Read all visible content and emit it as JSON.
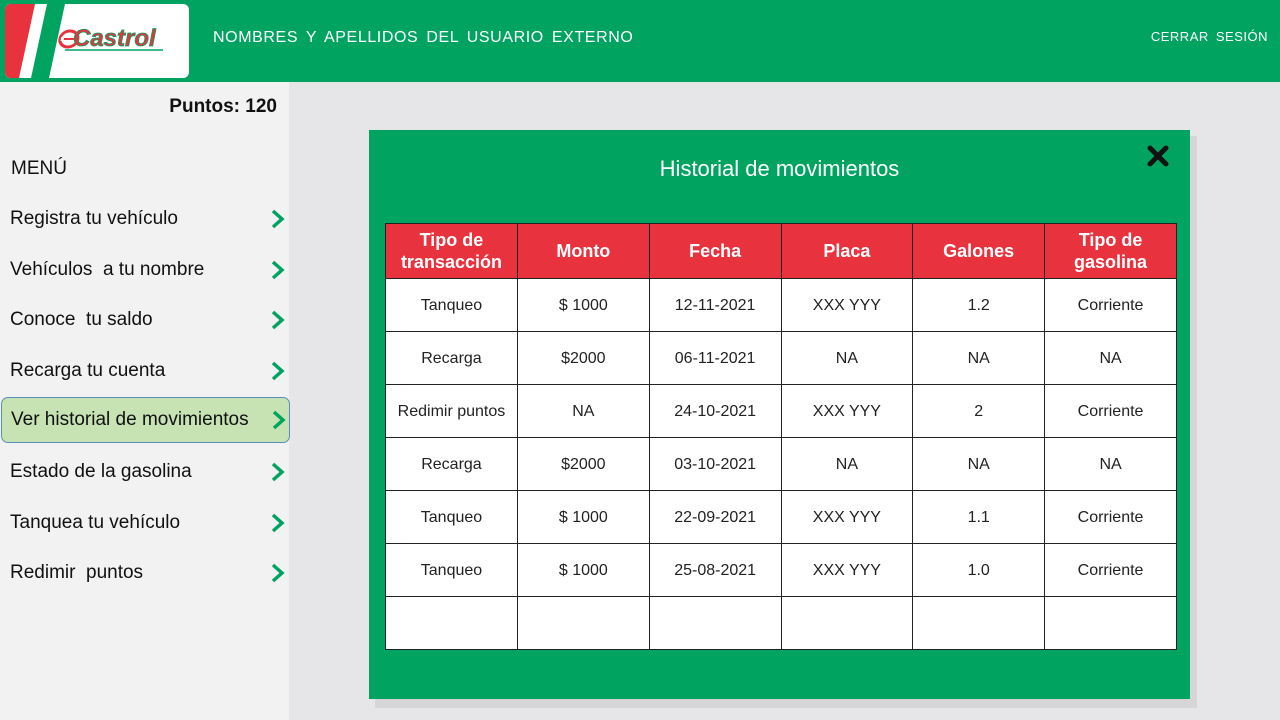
{
  "header": {
    "logo_text": "Castrol",
    "user_name": "NOMBRES Y APELLIDOS DEL USUARIO EXTERNO",
    "logout_label": "CERRAR SESIÓN",
    "colors": {
      "brand_green": "#00a460",
      "brand_red": "#e8323e"
    }
  },
  "sidebar": {
    "points_label": "Puntos: 120",
    "menu_title": "MENÚ",
    "items": [
      {
        "label": "Registra tu vehículo",
        "icon": "chevron-right-icon"
      },
      {
        "label": "Vehículos  a tu nombre",
        "icon": "chevron-right-icon"
      },
      {
        "label": "Conoce  tu saldo",
        "icon": "chevron-right-icon"
      },
      {
        "label": "Recarga tu cuenta",
        "icon": "chevron-right-icon"
      },
      {
        "label": "Ver historial de movimientos",
        "icon": "chevron-right-icon",
        "active": true
      },
      {
        "label": "Estado de la gasolina",
        "icon": "chevron-right-icon"
      },
      {
        "label": "Tanquea tu vehículo",
        "icon": "chevron-right-icon"
      },
      {
        "label": "Redimir  puntos",
        "icon": "chevron-right-icon"
      }
    ]
  },
  "modal": {
    "title": "Historial de movimientos",
    "close_icon": "close-x-icon",
    "columns": [
      "Tipo de transacción",
      "Monto",
      "Fecha",
      "Placa",
      "Galones",
      "Tipo de gasolina"
    ],
    "rows": [
      [
        "Tanqueo",
        "$ 1000",
        "12-11-2021",
        "XXX YYY",
        "1.2",
        "Corriente"
      ],
      [
        "Recarga",
        "$2000",
        "06-11-2021",
        "NA",
        "NA",
        "NA"
      ],
      [
        "Redimir puntos",
        "NA",
        "24-10-2021",
        "XXX YYY",
        "2",
        "Corriente"
      ],
      [
        "Recarga",
        "$2000",
        "03-10-2021",
        "NA",
        "NA",
        "NA"
      ],
      [
        "Tanqueo",
        "$ 1000",
        "22-09-2021",
        "XXX YYY",
        "1.1",
        "Corriente"
      ],
      [
        "Tanqueo",
        "$ 1000",
        "25-08-2021",
        "XXX YYY",
        "1.0",
        "Corriente"
      ],
      [
        "",
        "",
        "",
        "",
        "",
        ""
      ]
    ]
  }
}
